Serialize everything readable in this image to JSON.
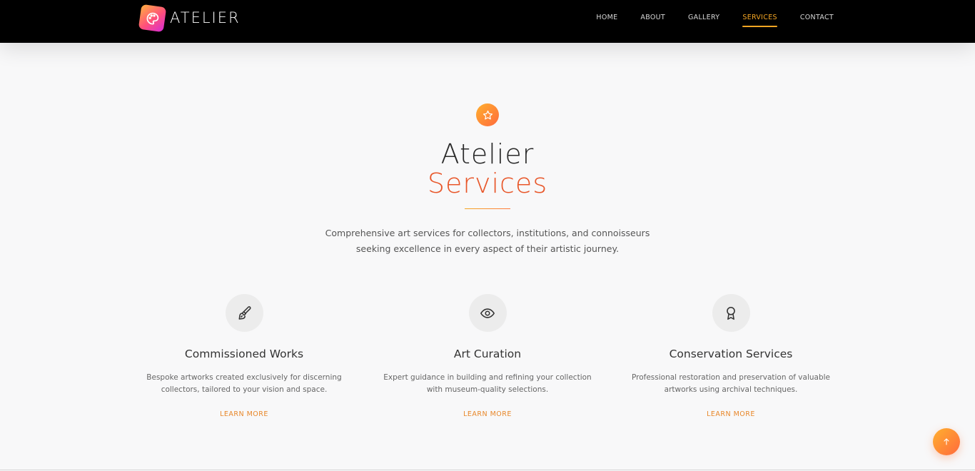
{
  "brand": {
    "name": "ATELIER",
    "icon": "palette-icon"
  },
  "nav": {
    "items": [
      {
        "label": "HOME",
        "active": false
      },
      {
        "label": "ABOUT",
        "active": false
      },
      {
        "label": "GALLERY",
        "active": false
      },
      {
        "label": "SERVICES",
        "active": true
      },
      {
        "label": "CONTACT",
        "active": false
      }
    ]
  },
  "section": {
    "badge_icon": "star-icon",
    "title_line1": "Atelier",
    "title_line2": "Services",
    "intro": "Comprehensive art services for collectors, institutions, and connoisseurs seeking excellence in every aspect of their artistic journey."
  },
  "services": [
    {
      "icon": "paintbrush-icon",
      "title": "Commissioned Works",
      "description": "Bespoke artworks created exclusively for discerning collectors, tailored to your vision and space.",
      "link": "LEARN MORE"
    },
    {
      "icon": "eye-icon",
      "title": "Art Curation",
      "description": "Expert guidance in building and refining your collection with museum-quality selections.",
      "link": "LEARN MORE"
    },
    {
      "icon": "award-icon",
      "title": "Conservation Services",
      "description": "Professional restoration and preservation of valuable artworks using archival techniques.",
      "link": "LEARN MORE"
    }
  ],
  "scroll_top_icon": "arrow-up-icon",
  "colors": {
    "accent": "#f5a623",
    "accent_dark": "#e8572a",
    "navbar_bg": "#000000",
    "page_bg": "#f8f8f9"
  }
}
